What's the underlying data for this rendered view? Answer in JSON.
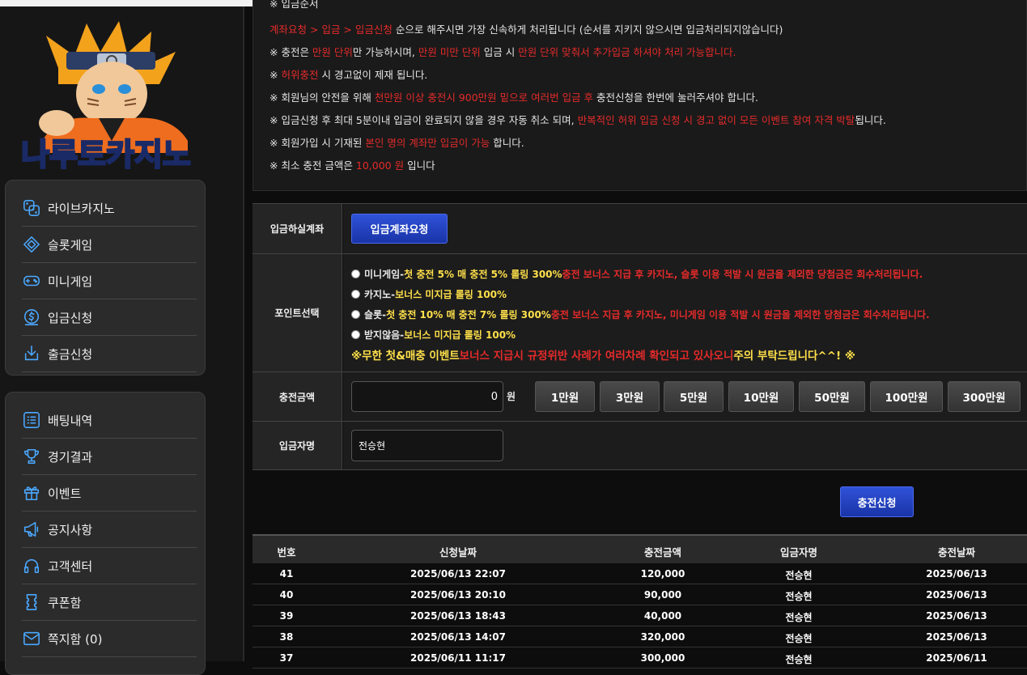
{
  "sidebar": {
    "logo_text": "나루토카지노",
    "menu_top": [
      {
        "label": "라이브카지노",
        "icon": "dice-icon"
      },
      {
        "label": "슬롯게임",
        "icon": "diamond-icon"
      },
      {
        "label": "미니게임",
        "icon": "gamepad-icon"
      },
      {
        "label": "입금신청",
        "icon": "dollar-coin-icon"
      },
      {
        "label": "출금신청",
        "icon": "download-icon"
      }
    ],
    "menu_bottom": [
      {
        "label": "배팅내역",
        "icon": "list-icon"
      },
      {
        "label": "경기결과",
        "icon": "trophy-icon"
      },
      {
        "label": "이벤트",
        "icon": "gift-icon"
      },
      {
        "label": "공지사항",
        "icon": "megaphone-icon"
      },
      {
        "label": "고객센터",
        "icon": "headset-icon"
      },
      {
        "label": "쿠폰함",
        "icon": "ticket-icon"
      },
      {
        "label": "쪽지함 (0)",
        "icon": "envelope-icon"
      }
    ]
  },
  "notice": {
    "top_cut": "※ 입금순서",
    "l1": {
      "a": "계좌요청",
      "b": " > ",
      "c": "입금",
      "d": " > ",
      "e": "입금신청",
      "f": " 순으로 해주시면 가장 신속하게 처리됩니다 (순서를 지키지 않으시면 입금처리되지않습니다)"
    },
    "l2": {
      "a": "※ 충전은 ",
      "b": "만원 단위",
      "c": "만 가능하시며, ",
      "d": "만원 미만 단위",
      "e": " 입금 시 ",
      "f": "만원 단위 맞춰서 추가입금 하셔야 처리 가능합니다."
    },
    "l3": {
      "a": "※ ",
      "b": "허위충전",
      "c": " 시 경고없이 제재 됩니다."
    },
    "l4": {
      "a": "※ 회원님의 안전을 위해 ",
      "b": "천만원 이상 충전시 900만원 밑으로 여러번 입금 후",
      "c": " 충전신청을 한번에 눌러주셔야 합니다."
    },
    "l5": {
      "a": "※ 입금신청 후 최대 5분이내 입금이 완료되지 않을 경우 자동 취소 되며, ",
      "b": "반복적인 허위 입금 신청 시 경고 없이 모든 이벤트 참여 자격 박탈",
      "c": "됩니다."
    },
    "l6": {
      "a": "※ 회원가입 시 기재된 ",
      "b": "본인 명의 계좌만 입금이 가능",
      "c": " 합니다."
    },
    "l7": {
      "a": "※ 최소 충전 금액은 ",
      "b": "10,000 원",
      "c": " 입니다"
    }
  },
  "form": {
    "account_label": "입금하실계좌",
    "account_button": "입금계좌요청",
    "point_label": "포인트선택",
    "options": [
      {
        "name": "미니게임",
        "sep": " - ",
        "yellow": "첫 충전 5% 매 충전 5% 롤링 300%",
        "red": " 충전 보너스 지급 후 카지노, 슬롯 이용 적발 시 원금을 제외한 당첨금은 회수처리됩니다."
      },
      {
        "name": "카지노",
        "sep": " - ",
        "yellow": "보너스 미지급 롤링 100%",
        "red": ""
      },
      {
        "name": "슬롯",
        "sep": " - ",
        "yellow": "첫 충전 10% 매 충전 7% 롤링 300%",
        "red": " 충전 보너스 지급 후 카지노, 미니게임 이용 적발 시 원금을 제외한 당첨금은 회수처리됩니다."
      },
      {
        "name": "받지않음",
        "sep": " - ",
        "yellow": "보너스 미지급 롤링 100%",
        "red": ""
      }
    ],
    "warning": {
      "a": "※무한 첫&매충 이벤트",
      "b": " 보너스 지급시 규정위반 사례가 여러차례 확인되고 있사오니",
      "c": " 주의 부탁드립니다^^! ※"
    },
    "amount_label": "충전금액",
    "amount_value": "0",
    "won": "원",
    "amount_buttons": [
      "1만원",
      "3만원",
      "5만원",
      "10만원",
      "50만원",
      "100만원",
      "300만원"
    ],
    "name_label": "입금자명",
    "name_value": "전승현",
    "submit": "충전신청"
  },
  "history": {
    "headers": [
      "번호",
      "신청날짜",
      "충전금액",
      "입금자명",
      "충전날짜"
    ],
    "rows": [
      [
        "41",
        "2025/06/13 22:07",
        "120,000",
        "전승현",
        "2025/06/13"
      ],
      [
        "40",
        "2025/06/13 20:10",
        "90,000",
        "전승현",
        "2025/06/13"
      ],
      [
        "39",
        "2025/06/13 18:43",
        "40,000",
        "전승현",
        "2025/06/13"
      ],
      [
        "38",
        "2025/06/13 14:07",
        "320,000",
        "전승현",
        "2025/06/13"
      ],
      [
        "37",
        "2025/06/11 11:17",
        "300,000",
        "전승현",
        "2025/06/11"
      ]
    ]
  },
  "colors": {
    "accent": "#4aa8ff",
    "red": "#e52a2a",
    "yellow": "#ffe04a",
    "button_blue": "#2f52d8"
  }
}
